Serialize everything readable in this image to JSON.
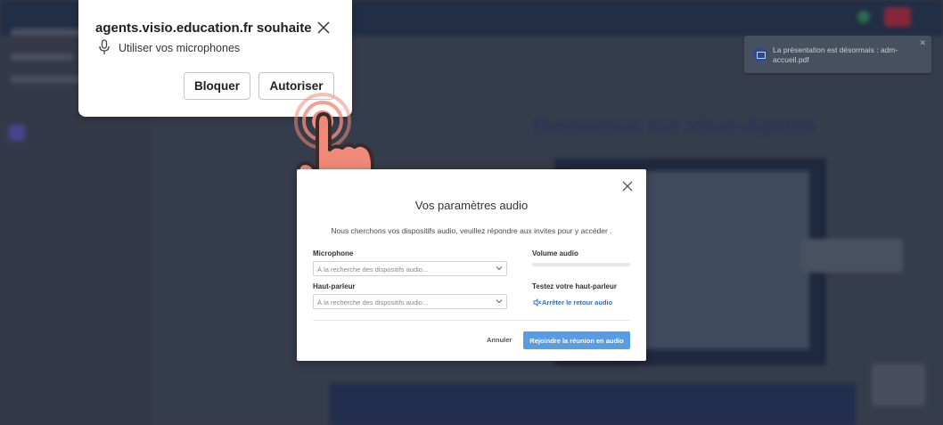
{
  "permission_prompt": {
    "site": "agents.visio.education.fr souhaite",
    "request": "Utiliser vos microphones",
    "block_label": "Bloquer",
    "allow_label": "Autoriser"
  },
  "toast": {
    "message": "La présentation est désormais : adm-accueil.pdf"
  },
  "audio_modal": {
    "title": "Vos paramètres audio",
    "description": "Nous cherchons vos dispositifs audio, veuillez répondre aux invites pour y accéder   .",
    "microphone_label": "Microphone",
    "microphone_value": "À la recherche des dispositifs audio...",
    "speaker_label": "Haut-parleur",
    "speaker_value": "À la recherche des dispositifs audio...",
    "volume_label": "Volume audio",
    "test_label": "Testez votre haut-parleur",
    "stop_label": "Arrêter le retour audio",
    "cancel_label": "Annuler",
    "join_label": "Rejoindre la réunion en audio"
  },
  "background": {
    "title": "Bienvenue sur Visio-Agents"
  },
  "colors": {
    "accent": "#5b9be0",
    "link": "#2a6fc4",
    "hand": "#f08a78"
  }
}
